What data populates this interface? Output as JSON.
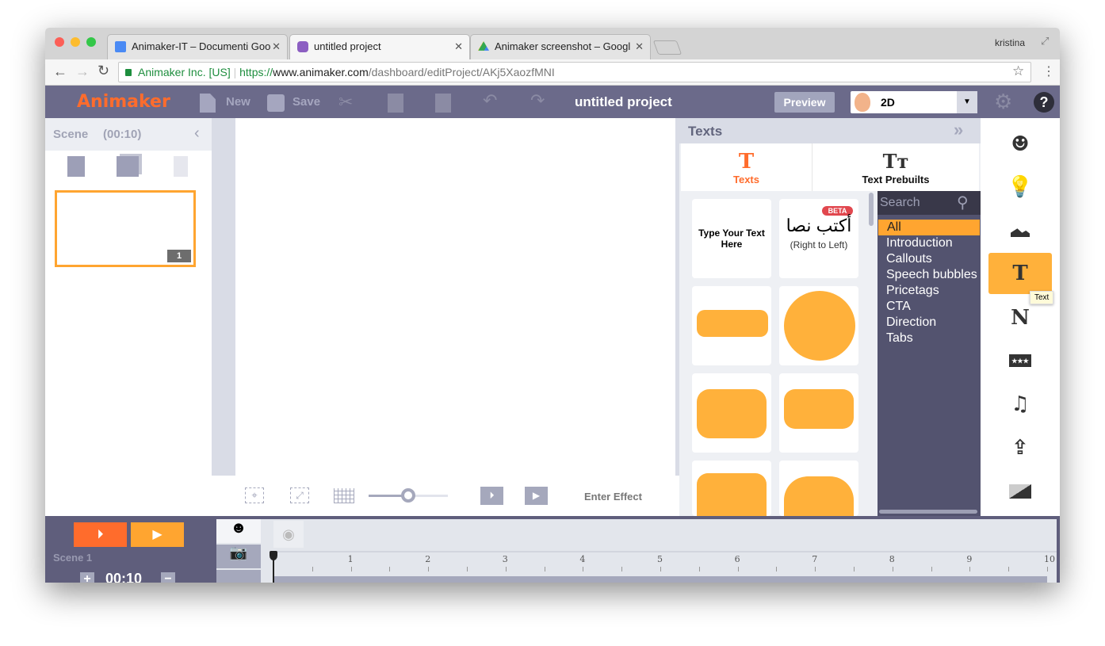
{
  "browser": {
    "tabs": [
      {
        "title": "Animaker-IT – Documenti Goo",
        "icon": "google-docs-icon",
        "active": false
      },
      {
        "title": "untitled project",
        "icon": "animaker-icon",
        "active": true
      },
      {
        "title": "Animaker screenshot – Googl",
        "icon": "google-drive-icon",
        "active": false
      }
    ],
    "user": "kristina",
    "url": {
      "org": "Animaker Inc. [US]",
      "scheme": "https://",
      "host": "www.animaker.com",
      "path": "/dashboard/editProject/AKj5XaozfMNI"
    }
  },
  "header": {
    "logo": "Animaker",
    "new_label": "New",
    "save_label": "Save",
    "project_title": "untitled project",
    "preview_label": "Preview",
    "mode_select": "2D",
    "accent": "#ff6c2c"
  },
  "scene_panel": {
    "title": "Scene",
    "duration": "(00:10)",
    "scene_number": "1"
  },
  "canvas_toolbar": {
    "enter_effect": "Enter Effect",
    "zoom_level": 0.5
  },
  "texts_panel": {
    "title": "Texts",
    "tabs": [
      {
        "label": "Texts",
        "active": true
      },
      {
        "label": "Text Prebuilts",
        "active": false
      }
    ],
    "cards": [
      {
        "text": "Type Your Text Here"
      },
      {
        "badge": "BETA",
        "arabic": "أكتب نصا",
        "subtext": "(Right to Left)"
      }
    ],
    "search_placeholder": "Search",
    "categories": [
      "All",
      "Introduction",
      "Callouts",
      "Speech bubbles",
      "Pricetags",
      "CTA",
      "Direction",
      "Tabs"
    ],
    "selected_category": "All"
  },
  "right_toolbar": {
    "items": [
      "character",
      "idea",
      "image",
      "text",
      "number",
      "rating",
      "music",
      "upload",
      "background"
    ],
    "active": "text",
    "tooltip": "Text"
  },
  "timeline": {
    "scene": "Scene 1",
    "duration": "00:10",
    "ticks": [
      "1",
      "2",
      "3",
      "4",
      "5",
      "6",
      "7",
      "8",
      "9",
      "10"
    ]
  }
}
